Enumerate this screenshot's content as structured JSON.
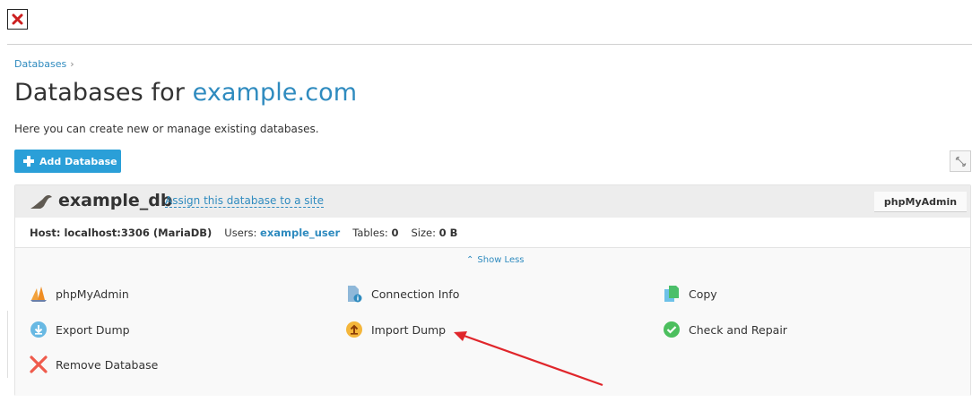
{
  "breadcrumb": {
    "label": "Databases"
  },
  "page": {
    "title_prefix": "Databases for ",
    "domain": "example.com",
    "hint": "Here you can create new or manage existing databases."
  },
  "toolbar": {
    "add_label": "Add Database"
  },
  "database": {
    "name": "example_db",
    "assign_label": "Assign this database to a site",
    "pma_label": "phpMyAdmin",
    "host_label": "Host: localhost:3306 (MariaDB)",
    "users_label": "Users:",
    "users_value": "example_user",
    "tables_label": "Tables:",
    "tables_value": "0",
    "size_label": "Size:",
    "size_value": "0 B",
    "show_less": "Show Less"
  },
  "actions": {
    "phpmyadmin": "phpMyAdmin",
    "connection_info": "Connection Info",
    "copy": "Copy",
    "export_dump": "Export Dump",
    "import_dump": "Import Dump",
    "check_repair": "Check and Repair",
    "remove_database": "Remove Database"
  },
  "colors": {
    "accent": "#2f8bbf",
    "button": "#2a9fd8",
    "annotation_arrow": "#e0262b"
  },
  "icons": {
    "close": "close-icon",
    "add": "plus-icon",
    "wrench": "wrench-icon",
    "db": "sea-lion-icon",
    "chevron_up": "chevron-up-icon"
  }
}
